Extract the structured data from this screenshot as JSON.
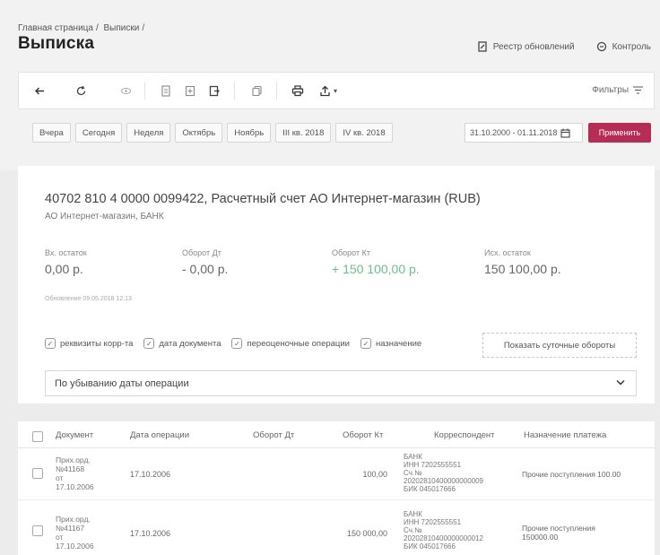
{
  "breadcrumb": [
    "Главная страница",
    "/",
    "Выписки",
    "/"
  ],
  "page_title": "Выписка",
  "top_links": {
    "registry": "Реестр обновлений",
    "control": "Контроль"
  },
  "toolbar": {
    "filters_label": "Фильтры",
    "icons": [
      "arrow-left-icon",
      "refresh-icon",
      "eye-icon",
      "document-icon",
      "document-add-icon",
      "export-icon",
      "copy-icon",
      "print-icon",
      "upload-icon"
    ]
  },
  "periods": [
    "Вчера",
    "Сегодня",
    "Неделя",
    "Октябрь",
    "Ноябрь",
    "III кв. 2018",
    "IV кв. 2018"
  ],
  "date_range": "31.10.2000 - 01.11.2018",
  "apply_label": "Применить",
  "account": {
    "title": "40702 810 4 0000 0099422, Расчетный счет АО Интернет-магазин (RUB)",
    "subtitle": "АО Интернет-магазин, БАНК"
  },
  "balances": {
    "opening_label": "Вх. остаток",
    "opening_value": "0,00 р.",
    "debit_label": "Оборот Дт",
    "debit_value": "- 0,00 р.",
    "credit_label": "Оборот Кт",
    "credit_value": "+ 150 100,00 р.",
    "closing_label": "Исх. остаток",
    "closing_value": "150 100,00 р."
  },
  "updated": "Обновление 09.05.2018 12:13",
  "options": {
    "req": "реквизиты корр-та",
    "docdate": "дата документа",
    "reval": "переоценочные операции",
    "purpose": "назначение",
    "daily": "Показать суточные обороты"
  },
  "sort_label": "По убыванию даты операции",
  "table": {
    "headers": {
      "document": "Документ",
      "date": "Дата операции",
      "debit": "Оборот Дт",
      "credit": "Оборот Кт",
      "correspondent": "Корреспондент",
      "purpose": "Назначение платежа"
    },
    "rows": [
      {
        "doc": [
          "Прих.орд.",
          "№41168",
          "от",
          "17.10.2006"
        ],
        "date": "17.10.2006",
        "debit": "",
        "credit": "100,00",
        "corr": [
          "БАНК",
          "ИНН 7202555551",
          "Сч.№",
          "20202810400000000009",
          "БИК 045017666"
        ],
        "purpose": [
          "Прочие поступления 100.00"
        ]
      },
      {
        "doc": [
          "Прих.орд.",
          "№41167",
          "от",
          "17.10.2006"
        ],
        "date": "17.10.2006",
        "debit": "",
        "credit": "150 000,00",
        "corr": [
          "БАНК",
          "ИНН 7202555551",
          "Сч.№",
          "20202810400000000012",
          "БИК 045017666"
        ],
        "purpose": [
          "Прочие поступления",
          "150000.00"
        ]
      }
    ]
  }
}
